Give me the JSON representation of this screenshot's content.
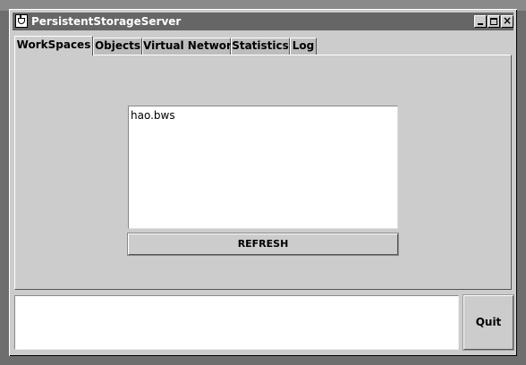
{
  "window": {
    "title": "PersistentStorageServer",
    "icon": "java-cup-icon"
  },
  "window_controls": {
    "minimize_icon": "minimize-icon",
    "maximize_icon": "maximize-icon",
    "close_icon": "close-icon",
    "close_glyph": "×"
  },
  "tabs": [
    {
      "label": "WorkSpaces",
      "selected": true
    },
    {
      "label": "Objects",
      "selected": false
    },
    {
      "label": "Virtual Network",
      "selected": false
    },
    {
      "label": "Statistics",
      "selected": false
    },
    {
      "label": "Log",
      "selected": false
    }
  ],
  "workspaces": {
    "items": [
      "hao.bws"
    ],
    "refresh_label": "REFRESH"
  },
  "status": {
    "text": ""
  },
  "quit_label": "Quit",
  "colors": {
    "background": "#cccccc",
    "titlebar": "#666666",
    "desktop": "#6e6e6e"
  }
}
